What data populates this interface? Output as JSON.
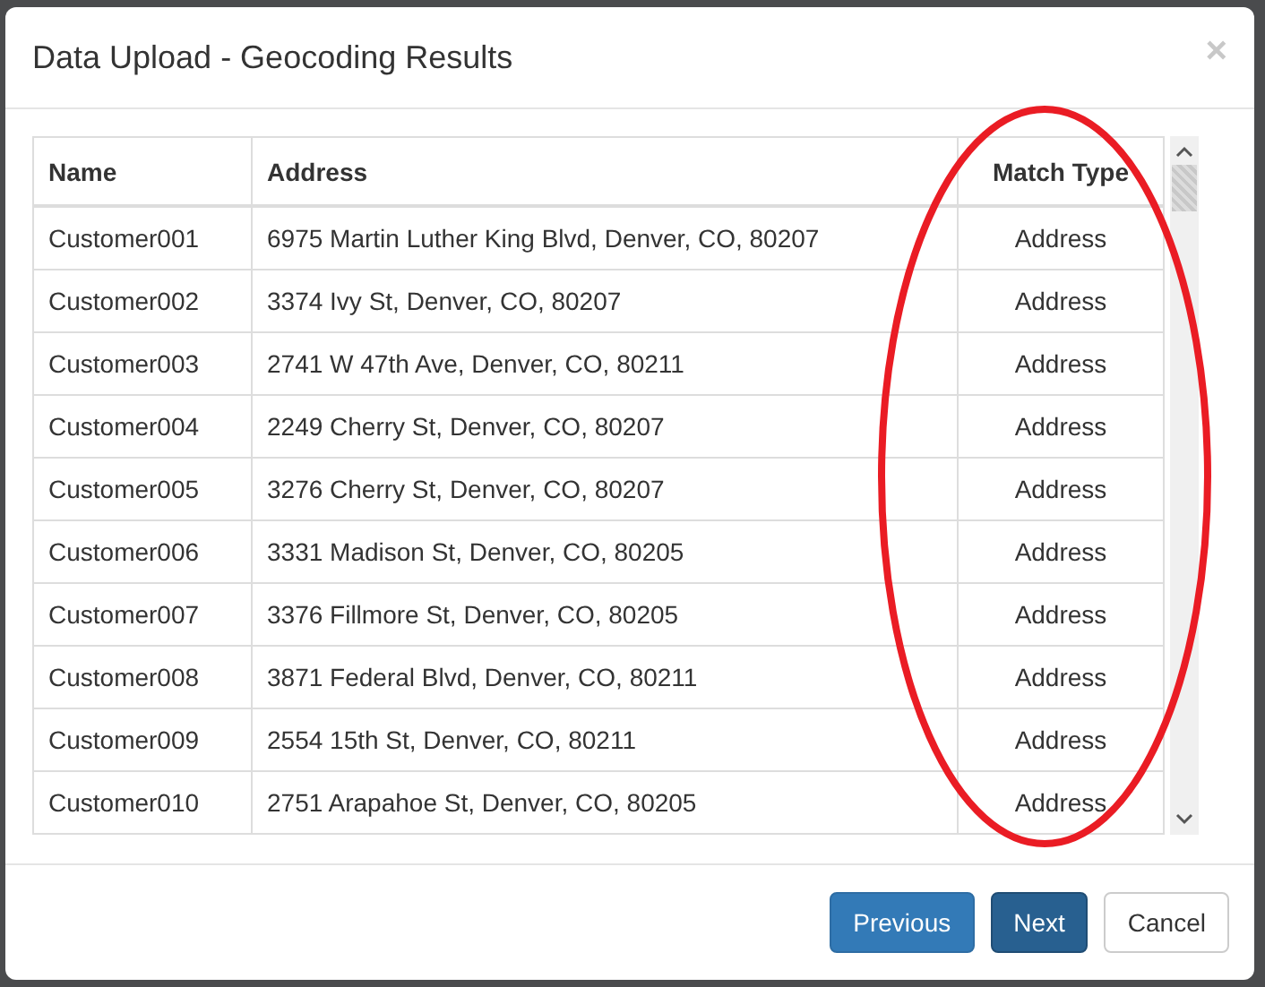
{
  "dialog": {
    "title": "Data Upload - Geocoding Results",
    "close": "×"
  },
  "table": {
    "columns": [
      {
        "label": "Name",
        "centered": false
      },
      {
        "label": "Address",
        "centered": false
      },
      {
        "label": "Match Type",
        "centered": true
      }
    ],
    "rows": [
      [
        "Customer001",
        "6975 Martin Luther King Blvd, Denver, CO, 80207",
        "Address"
      ],
      [
        "Customer002",
        "3374 Ivy St, Denver, CO, 80207",
        "Address"
      ],
      [
        "Customer003",
        "2741 W 47th Ave, Denver, CO, 80211",
        "Address"
      ],
      [
        "Customer004",
        "2249 Cherry St, Denver, CO, 80207",
        "Address"
      ],
      [
        "Customer005",
        "3276 Cherry St, Denver, CO, 80207",
        "Address"
      ],
      [
        "Customer006",
        "3331 Madison St, Denver, CO, 80205",
        "Address"
      ],
      [
        "Customer007",
        "3376 Fillmore St, Denver, CO, 80205",
        "Address"
      ],
      [
        "Customer008",
        "3871 Federal Blvd, Denver, CO, 80211",
        "Address"
      ],
      [
        "Customer009",
        "2554 15th St, Denver, CO, 80211",
        "Address"
      ],
      [
        "Customer010",
        "2751 Arapahoe St, Denver, CO, 80205",
        "Address"
      ]
    ]
  },
  "annotation": {
    "kind": "ellipse"
  },
  "buttons": [
    {
      "label": "Previous",
      "kind": "primary"
    },
    {
      "label": "Next",
      "kind": "active"
    },
    {
      "label": "Cancel",
      "kind": "default"
    }
  ]
}
